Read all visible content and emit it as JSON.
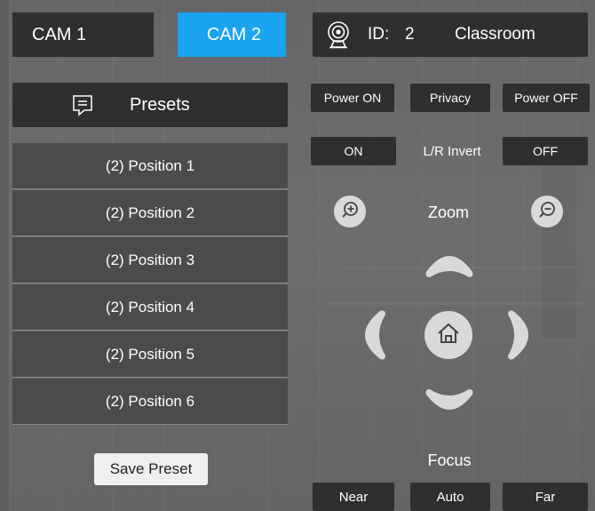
{
  "cameras": {
    "cam1_label": "CAM 1",
    "cam2_label": "CAM 2",
    "selected": "CAM 2"
  },
  "header": {
    "id_label": "ID:",
    "id_value": "2",
    "room": "Classroom"
  },
  "presets": {
    "title": "Presets",
    "items": [
      {
        "label": "(2) Position 1"
      },
      {
        "label": "(2) Position 2"
      },
      {
        "label": "(2) Position 3"
      },
      {
        "label": "(2) Position 4"
      },
      {
        "label": "(2) Position 5"
      },
      {
        "label": "(2) Position 6"
      }
    ],
    "save_label": "Save Preset"
  },
  "power": {
    "on_label": "Power ON",
    "privacy_label": "Privacy",
    "off_label": "Power OFF"
  },
  "invert": {
    "on_label": "ON",
    "title": "L/R Invert",
    "off_label": "OFF"
  },
  "zoom": {
    "title": "Zoom"
  },
  "focus": {
    "title": "Focus",
    "near_label": "Near",
    "auto_label": "Auto",
    "far_label": "Far"
  },
  "colors": {
    "accent": "#1aa4ef",
    "button_dark": "#2e2f30",
    "preset_bg": "#4a4b4d",
    "control_light": "#d9d9d9"
  },
  "icons": [
    "webcam-icon",
    "bookmark-icon",
    "zoom-in-icon",
    "zoom-out-icon",
    "home-icon",
    "arrow-up-icon",
    "arrow-down-icon",
    "arrow-left-icon",
    "arrow-right-icon"
  ]
}
